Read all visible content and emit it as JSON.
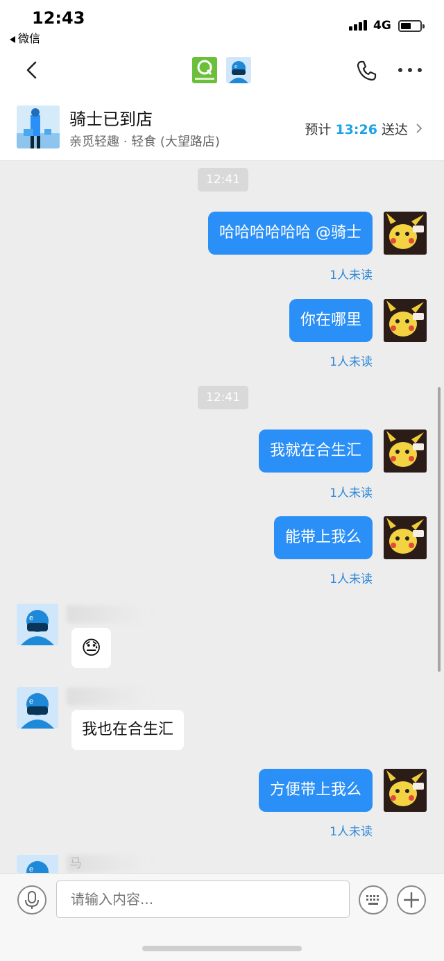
{
  "status_bar": {
    "time": "12:43",
    "back_app": "微信",
    "network": "4G"
  },
  "nav": {
    "back_icon": "chevron-left-icon",
    "phone_icon": "phone-icon",
    "more_icon": "more-dots-icon"
  },
  "order": {
    "status": "骑士已到店",
    "shop": "亲觅轻趣 · 轻食 (大望路店)",
    "eta_prefix": "预计",
    "eta_time": "13:26",
    "eta_suffix": "送达"
  },
  "messages": {
    "ts1": "12:41",
    "m1": "哈哈哈哈哈哈 @骑士",
    "m2": "你在哪里",
    "ts2": "12:41",
    "m3": "我就在合生汇",
    "m4": "能带上我么",
    "r1_emoji": "😓",
    "r2": "我也在合生汇",
    "m5": "方便带上我么",
    "unread": "1人未读",
    "partial_name": "马"
  },
  "input": {
    "placeholder": "请输入内容..."
  },
  "colors": {
    "accent": "#2a8ff6",
    "eta": "#1aa3e8",
    "unread": "#2d89d9",
    "online": "#23c34b"
  }
}
